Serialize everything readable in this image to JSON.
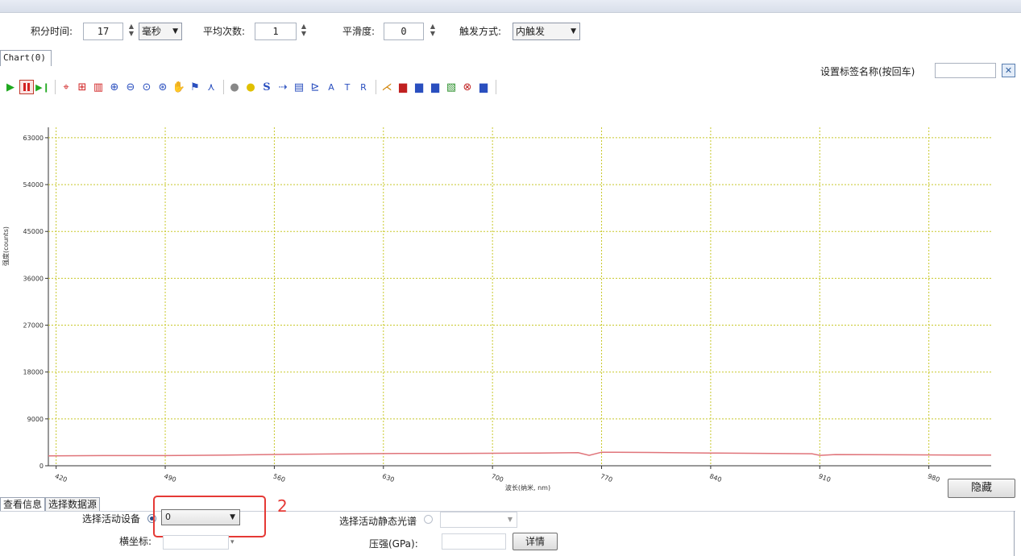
{
  "toolbar": {
    "integration_label": "积分时间:",
    "integration_value": "17",
    "unit_selected": "毫秒",
    "avg_label": "平均次数:",
    "avg_value": "1",
    "smooth_label": "平滑度:",
    "smooth_value": "0",
    "trigger_label": "触发方式:",
    "trigger_selected": "内触发"
  },
  "chart_tab": "Chart(0)",
  "tag": {
    "label": "设置标签名称(按回车)",
    "value": ""
  },
  "icons": [
    "play-icon",
    "pause-icon",
    "step-icon",
    "crosshair-icon",
    "grid-icon",
    "panel-icon",
    "zoom-in-icon",
    "zoom-out-icon",
    "zoom-reset-icon",
    "zoom-fit-icon",
    "pan-hand-icon",
    "marker-icon",
    "peak-icon",
    "bulb-off-icon",
    "bulb-on-icon",
    "smooth-s-icon",
    "probe-icon",
    "bars-icon",
    "baseline-icon",
    "label-a-icon",
    "label-t-icon",
    "label-r-icon",
    "fit-icon",
    "save-chart-icon",
    "load-chart-icon",
    "export-chart-icon",
    "compare-icon",
    "delete-icon",
    "print-icon"
  ],
  "colors": {
    "accent": "#2f5f9e",
    "series": "#e0747a",
    "grid": "#c8c82a",
    "annotation": "#e53935"
  },
  "chart_data": {
    "type": "line",
    "xlabel": "波长(纳米, nm)",
    "ylabel": "强度(counts)",
    "xlim": [
      415,
      1020
    ],
    "ylim": [
      0,
      65000
    ],
    "x_ticks": [
      "420",
      "490",
      "560",
      "630",
      "700",
      "770",
      "840",
      "910",
      "980"
    ],
    "y_ticks": [
      "0",
      "9000",
      "18000",
      "27000",
      "36000",
      "45000",
      "54000",
      "63000"
    ],
    "grid": true,
    "series": [
      {
        "x": [
          415,
          450,
          490,
          530,
          570,
          610,
          640,
          670,
          700,
          730,
          755,
          762,
          770,
          800,
          840,
          880,
          905,
          910,
          920,
          960,
          1000,
          1020
        ],
        "y": [
          1900,
          1950,
          1950,
          2050,
          2200,
          2300,
          2350,
          2350,
          2400,
          2450,
          2500,
          2000,
          2600,
          2550,
          2450,
          2350,
          2300,
          2000,
          2150,
          2100,
          2050,
          2050
        ]
      }
    ]
  },
  "hide_button": "隐藏",
  "bottom_tabs": [
    "查看信息",
    "选择数据源"
  ],
  "device": {
    "label": "选择活动设备",
    "selected": "0"
  },
  "annotation_number": "2",
  "static_spectrum": {
    "label": "选择活动静态光谱",
    "selected": ""
  },
  "xcoord": {
    "label": "横坐标:",
    "value": ""
  },
  "pressure": {
    "label": "压强(GPa):",
    "value": ""
  },
  "detail_button": "详情"
}
